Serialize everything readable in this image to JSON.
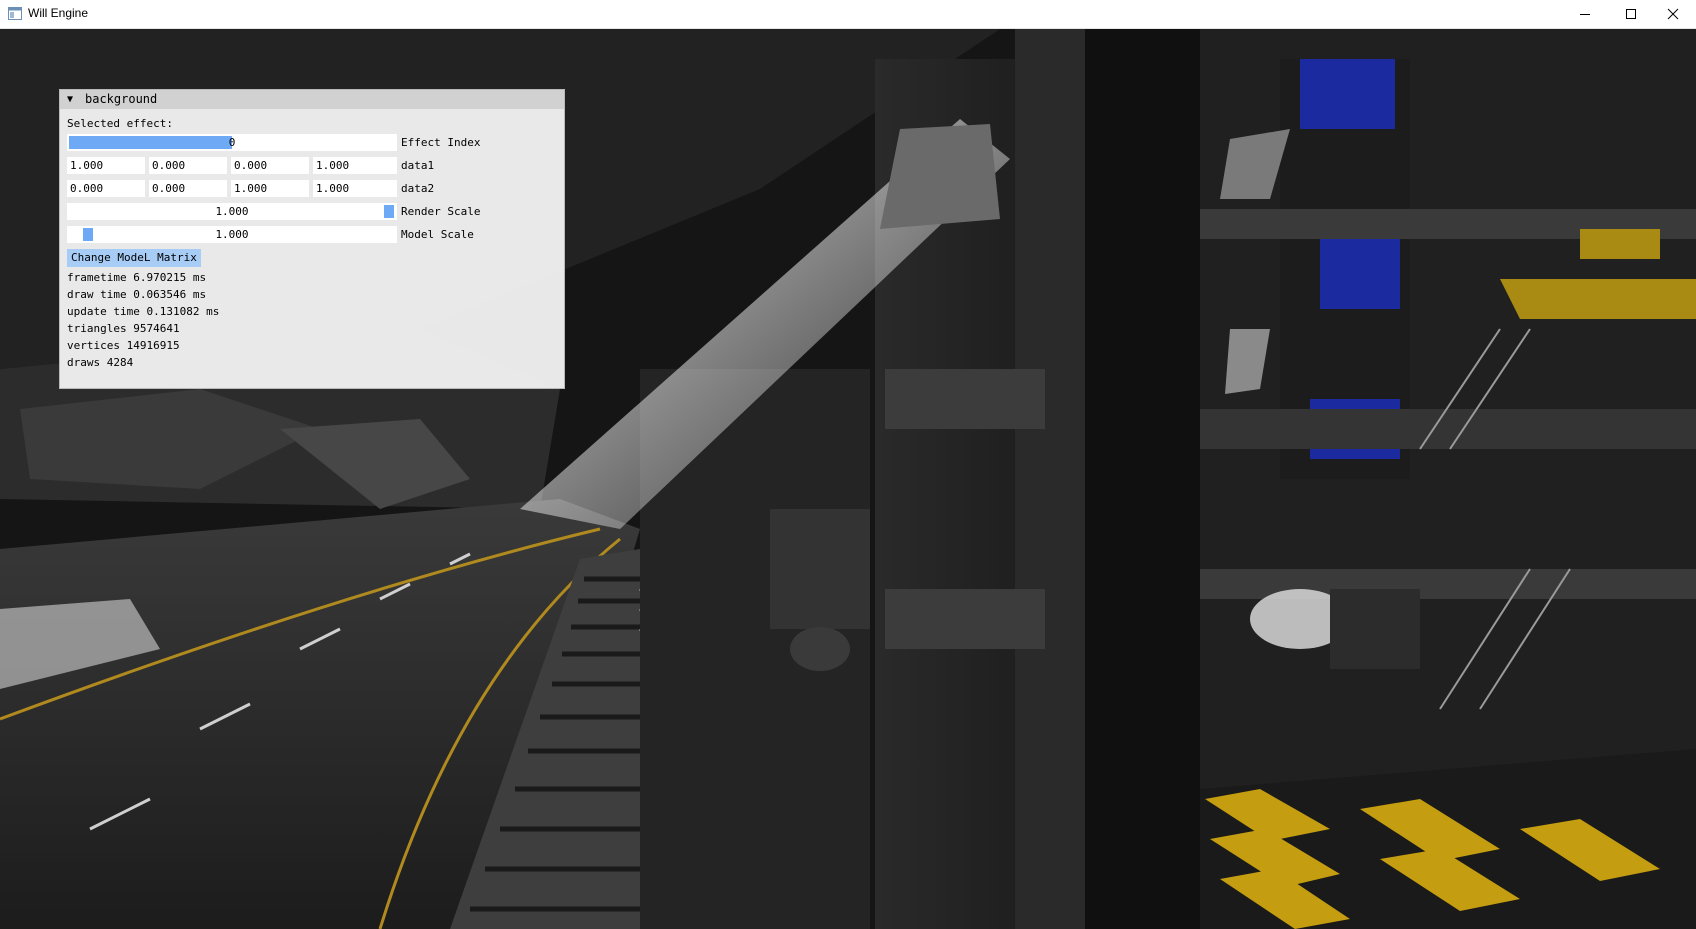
{
  "window": {
    "title": "Will Engine",
    "controls": [
      "minimize",
      "maximize",
      "close"
    ]
  },
  "imgui": {
    "header_title": "background",
    "selected_effect_label": "Selected effect:",
    "effect_index": {
      "value": "0",
      "label": "Effect Index",
      "fill_fraction": 0.5
    },
    "data1": {
      "values": [
        "1.000",
        "0.000",
        "0.000",
        "1.000"
      ],
      "label": "data1"
    },
    "data2": {
      "values": [
        "0.000",
        "0.000",
        "1.000",
        "1.000"
      ],
      "label": "data2"
    },
    "render_scale": {
      "value": "1.000",
      "label": "Render Scale",
      "grab_fraction": 1.0
    },
    "model_scale": {
      "value": "1.000",
      "label": "Model Scale",
      "grab_fraction": 0.05
    },
    "change_model_button": "Change ModeL Matrix",
    "stats": {
      "frametime": "frametime 6.970215 ms",
      "draw_time": "draw time 0.063546 ms",
      "update_time": "update time 0.131082 ms",
      "triangles": "triangles 9574641",
      "vertices": "vertices 14916915",
      "draws": "draws 4284"
    }
  },
  "colors": {
    "accent": "#6ea9f5",
    "button": "#a7cdf6",
    "panel_bg": "#f0f0f0",
    "header_bg": "#d1d1d1"
  },
  "icons": {
    "app": "app-window-icon",
    "collapse": "collapse-triangle-icon",
    "minimize": "minimize-icon",
    "maximize": "maximize-icon",
    "close": "close-icon"
  }
}
